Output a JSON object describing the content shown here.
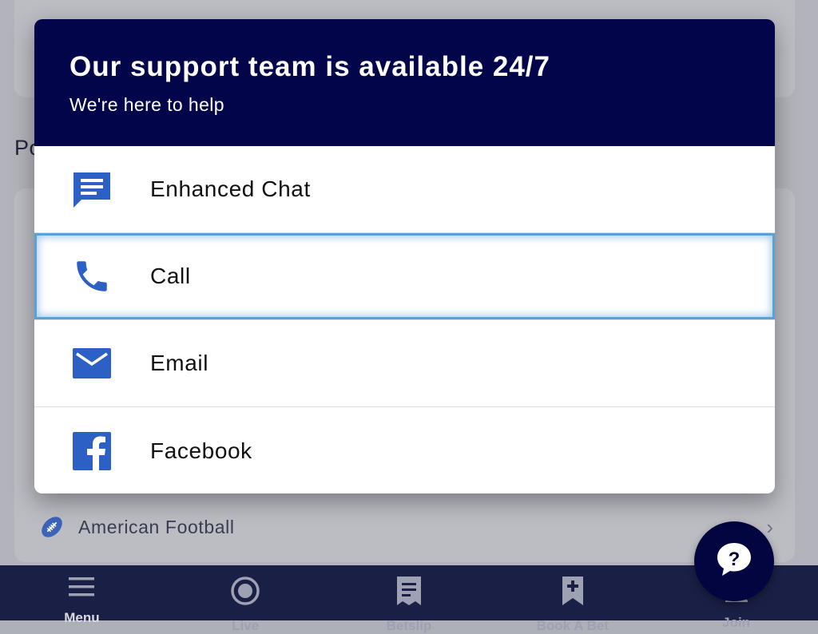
{
  "background": {
    "section_title": "Po",
    "sport_row": {
      "icon": "american-football-icon",
      "label": "American Football"
    }
  },
  "modal": {
    "title": "Our support team is available 24/7",
    "subtitle": "We're here to help",
    "options": [
      {
        "label": "Enhanced Chat",
        "icon": "chat-icon"
      },
      {
        "label": "Call",
        "icon": "phone-icon"
      },
      {
        "label": "Email",
        "icon": "email-icon"
      },
      {
        "label": "Facebook",
        "icon": "facebook-icon"
      }
    ],
    "focused_option": "Call"
  },
  "bottom_nav": {
    "items": [
      {
        "label": "Menu",
        "icon": "menu-icon"
      },
      {
        "label": "Live",
        "icon": "live-icon"
      },
      {
        "label": "Betslip",
        "icon": "betslip-icon"
      },
      {
        "label": "Book A Bet",
        "icon": "book-a-bet-icon"
      },
      {
        "label": "Join",
        "icon": "join-icon"
      }
    ]
  },
  "help_button": {
    "icon": "help-question-icon"
  },
  "colors": {
    "brand_navy": "#03054a",
    "icon_blue": "#2c60c4",
    "focus_ring": "#5aa1d8",
    "nav_background": "#1a1f45"
  }
}
